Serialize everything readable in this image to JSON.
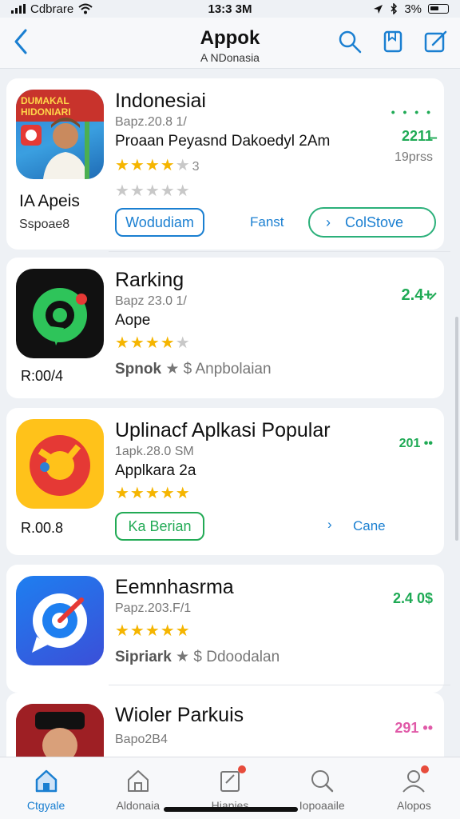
{
  "status": {
    "carrier": "Cdbrare",
    "time": "13:3 3M",
    "battery": "3%"
  },
  "nav": {
    "title": "Appok",
    "subtitle": "A NDonasia"
  },
  "apps": [
    {
      "name": "Indonesiai",
      "version": "Bapz.20.8 1/",
      "subtitle": "Proaan Peyasnd Dakoedyl 2Am",
      "rating": 4,
      "rating_count": "3",
      "second_rating": 0,
      "price": "2211̶",
      "price_sub": "19prss",
      "price_dots": "• • • •",
      "side_label": "IA Apeis",
      "side_sub": "Sspoae8",
      "icon_text": "DUMAKAL HIDONIARI",
      "btn_primary": "Wodudiam",
      "link": "Fanst",
      "btn_secondary": "ColStove",
      "btn_secondary_chev": "›"
    },
    {
      "name": "Rarking",
      "version": "Bapz 23.0 1/",
      "subtitle": "Aope",
      "rating": 4,
      "price": "2.4+̷",
      "side_label": "R:00/4",
      "grey_bold": "Spnok",
      "grey_rest": "Anpbolaian",
      "grey_sym": "★ $"
    },
    {
      "name": "Uplinacf Aplkasi Popular",
      "version": "1apk.28.0 SM",
      "subtitle": "Applkara 2a",
      "rating": 5,
      "price": "201 ••",
      "side_label": "R.00.8",
      "btn_primary": "Ka Berian",
      "link_chev": "›",
      "link": "Cane"
    },
    {
      "name": "Eemnhasrma",
      "version": "Papz.203.F/1",
      "rating": 5,
      "price": "2.4 0$",
      "grey_bold": "Sipriark",
      "grey_rest": "Ddoodalan",
      "grey_sym": "★ $"
    },
    {
      "name": "Wioler Parkuis",
      "version": "Bapo2B4",
      "price": "291 ••"
    }
  ],
  "tabs": [
    {
      "label": "Ctgyale",
      "icon": "home-icon",
      "active": true
    },
    {
      "label": "Aldonaia",
      "icon": "house-outline-icon"
    },
    {
      "label": "Hiapjes",
      "icon": "updates-icon"
    },
    {
      "label": "Iopoaaile",
      "icon": "search-icon"
    },
    {
      "label": "Alopos",
      "icon": "profile-icon"
    }
  ],
  "colors": {
    "accent": "#1a7fd1",
    "price_green": "#1faa55",
    "star": "#f5b500"
  }
}
